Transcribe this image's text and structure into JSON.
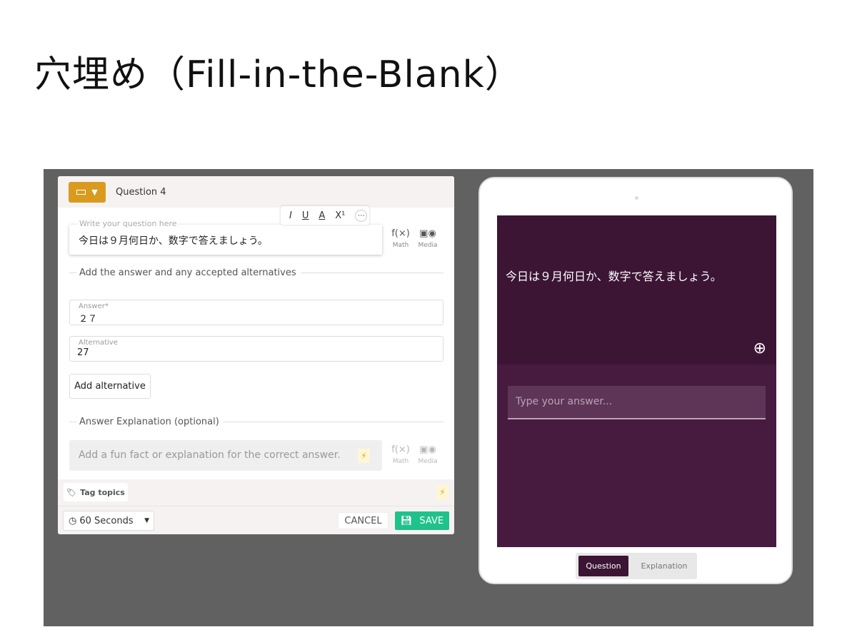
{
  "slide_title": "穴埋め（Fill-in-the-Blank）",
  "editor": {
    "question_label": "Question 4",
    "toolbar": {
      "italic": "I",
      "underline": "U",
      "color": "A",
      "superscript": "X¹",
      "more": "⋯"
    },
    "question_placeholder": "Write your question here",
    "question_text": "今日は９月何日か、数字で答えましょう。",
    "math_label": "Math",
    "media_label": "Media",
    "answers_section": "Add the answer and any accepted alternatives",
    "answer_label": "Answer*",
    "answer_value": "２７",
    "alternative_label": "Alternative",
    "alternative_value": "27",
    "add_alternative": "Add alternative",
    "explanation_section": "Answer Explanation (optional)",
    "explanation_placeholder": "Add a fun fact or explanation for the correct answer.",
    "tag_topics": "Tag topics",
    "time_select": "60 Seconds",
    "cancel": "CANCEL",
    "save": "SAVE"
  },
  "preview": {
    "question_text": "今日は９月何日か、数字で答えましょう。",
    "answer_placeholder": "Type your answer...",
    "tabs": [
      "Question",
      "Explanation"
    ],
    "active_tab": "Question"
  },
  "colors": {
    "accent": "#d99b1f",
    "save": "#1fc28a",
    "preview_bg": "#471a40"
  }
}
